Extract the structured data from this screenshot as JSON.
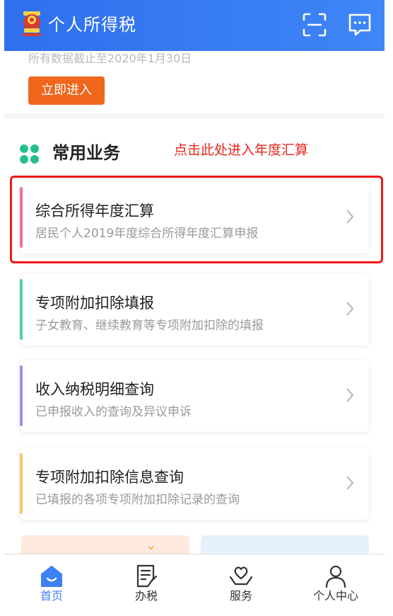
{
  "header": {
    "title": "个人所得税",
    "emblem_icon": "tax-emblem-icon",
    "scan_icon": "scan-icon",
    "message_icon": "message-icon",
    "background": "#3b7ff3"
  },
  "notice": {
    "deadline_text": "所有数据截止至2020年1月30日",
    "enter_label": "立即进入",
    "enter_color": "#f0661d"
  },
  "services": {
    "section_title": "常用业务",
    "hint": "点击此处进入年度汇算",
    "hint_color": "#e8241b",
    "items": [
      {
        "title": "综合所得年度汇算",
        "desc": "居民个人2019年度综合所得年度汇算申报",
        "accent": "#f2709a"
      },
      {
        "title": "专项附加扣除填报",
        "desc": "子女教育、继续教育等专项附加扣除的填报",
        "accent": "#4fd3a2"
      },
      {
        "title": "收入纳税明细查询",
        "desc": "已申报收入的查询及异议申诉",
        "accent": "#9d8ff0"
      },
      {
        "title": "专项附加扣除信息查询",
        "desc": "已填报的各项专项附加扣除记录的查询",
        "accent": "#f7c66a"
      }
    ]
  },
  "tabbar": {
    "active_color": "#3d7ff5",
    "tabs": [
      {
        "label": "首页",
        "icon": "home-icon"
      },
      {
        "label": "办税",
        "icon": "document-icon"
      },
      {
        "label": "服务",
        "icon": "heart-hands-icon"
      },
      {
        "label": "个人中心",
        "icon": "person-icon"
      }
    ]
  }
}
